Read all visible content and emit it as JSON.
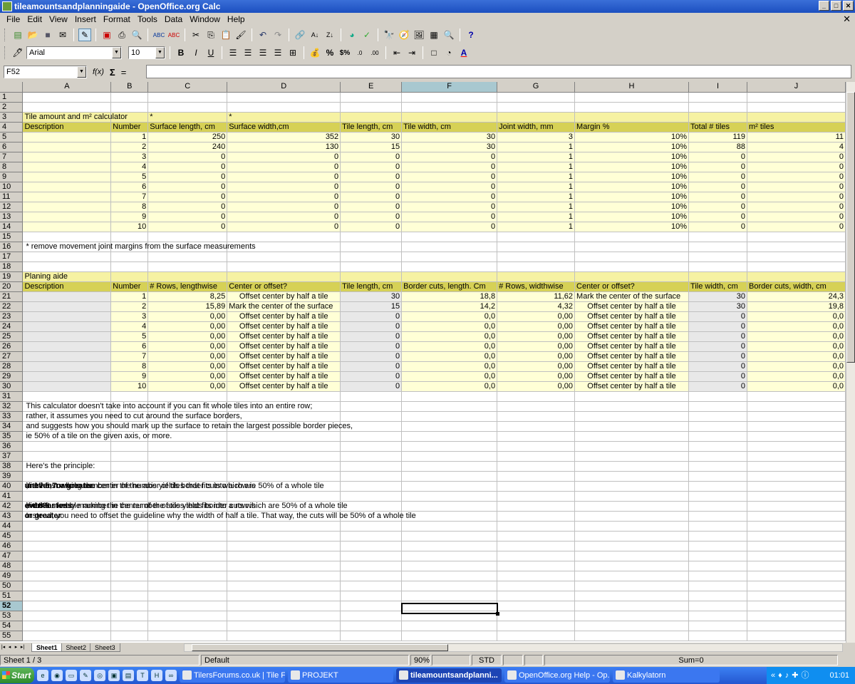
{
  "window": {
    "title": "tileamountsandplanningaide - OpenOffice.org Calc",
    "min": "_",
    "max": "□",
    "close": "✕"
  },
  "menu": [
    "File",
    "Edit",
    "View",
    "Insert",
    "Format",
    "Tools",
    "Data",
    "Window",
    "Help"
  ],
  "toolbar2": {
    "font": "Arial",
    "size": "10",
    "bold": "B",
    "italic": "I",
    "underline": "U",
    "percent": "%",
    "currency": "$%"
  },
  "formula": {
    "namebox": "F52",
    "fx": "f(x)",
    "sigma": "Σ",
    "equals": "="
  },
  "columns": [
    "A",
    "B",
    "C",
    "D",
    "E",
    "F",
    "G",
    "H",
    "I",
    "J"
  ],
  "selected_column": "F",
  "selected_row": "52",
  "calc": {
    "title": "Tile amount and m² calculator",
    "star": "*",
    "headers": [
      "Description",
      "Number",
      "Surface length, cm",
      "Surface width,cm",
      "Tile length, cm",
      "Tile width, cm",
      "Joint width, mm",
      "Margin %",
      "Total # tiles",
      "m² tiles"
    ],
    "rows": [
      [
        "",
        "1",
        "250",
        "352",
        "30",
        "30",
        "3",
        "10%",
        "119",
        "11"
      ],
      [
        "",
        "2",
        "240",
        "130",
        "15",
        "30",
        "1",
        "10%",
        "88",
        "4"
      ],
      [
        "",
        "3",
        "0",
        "0",
        "0",
        "0",
        "1",
        "10%",
        "0",
        "0"
      ],
      [
        "",
        "4",
        "0",
        "0",
        "0",
        "0",
        "1",
        "10%",
        "0",
        "0"
      ],
      [
        "",
        "5",
        "0",
        "0",
        "0",
        "0",
        "1",
        "10%",
        "0",
        "0"
      ],
      [
        "",
        "6",
        "0",
        "0",
        "0",
        "0",
        "1",
        "10%",
        "0",
        "0"
      ],
      [
        "",
        "7",
        "0",
        "0",
        "0",
        "0",
        "1",
        "10%",
        "0",
        "0"
      ],
      [
        "",
        "8",
        "0",
        "0",
        "0",
        "0",
        "1",
        "10%",
        "0",
        "0"
      ],
      [
        "",
        "9",
        "0",
        "0",
        "0",
        "0",
        "1",
        "10%",
        "0",
        "0"
      ],
      [
        "",
        "10",
        "0",
        "0",
        "0",
        "0",
        "1",
        "10%",
        "0",
        "0"
      ]
    ],
    "note": "* remove movement joint margins from the surface measurements"
  },
  "plan": {
    "title": "Planing aide",
    "headers": [
      "Description",
      "Number",
      "# Rows, lengthwise",
      "Center or offset?",
      "Tile length, cm",
      "Border cuts, length. Cm",
      "# Rows, widthwise",
      "Center or offset?",
      "Tile width, cm",
      "Border cuts, width, cm"
    ],
    "rows": [
      [
        "",
        "1",
        "8,25",
        "Offset center by half a tile",
        "30",
        "18,8",
        "11,62",
        "Mark the center of the surface",
        "30",
        "24,3"
      ],
      [
        "",
        "2",
        "15,89",
        "Mark the center of the surface",
        "15",
        "14,2",
        "4,32",
        "Offset center by half a tile",
        "30",
        "19,8"
      ],
      [
        "",
        "3",
        "0,00",
        "Offset center by half a tile",
        "0",
        "0,0",
        "0,00",
        "Offset center by half a tile",
        "0",
        "0,0"
      ],
      [
        "",
        "4",
        "0,00",
        "Offset center by half a tile",
        "0",
        "0,0",
        "0,00",
        "Offset center by half a tile",
        "0",
        "0,0"
      ],
      [
        "",
        "5",
        "0,00",
        "Offset center by half a tile",
        "0",
        "0,0",
        "0,00",
        "Offset center by half a tile",
        "0",
        "0,0"
      ],
      [
        "",
        "6",
        "0,00",
        "Offset center by half a tile",
        "0",
        "0,0",
        "0,00",
        "Offset center by half a tile",
        "0",
        "0,0"
      ],
      [
        "",
        "7",
        "0,00",
        "Offset center by half a tile",
        "0",
        "0,0",
        "0,00",
        "Offset center by half a tile",
        "0",
        "0,0"
      ],
      [
        "",
        "8",
        "0,00",
        "Offset center by half a tile",
        "0",
        "0,0",
        "0,00",
        "Offset center by half a tile",
        "0",
        "0,0"
      ],
      [
        "",
        "9",
        "0,00",
        "Offset center by half a tile",
        "0",
        "0,0",
        "0,00",
        "Offset center by half a tile",
        "0",
        "0,0"
      ],
      [
        "",
        "10",
        "0,00",
        "Offset center by half a tile",
        "0",
        "0,0",
        "0,00",
        "Offset center by half a tile",
        "0",
        "0,0"
      ]
    ]
  },
  "text": {
    "r32": "This calculator doesn't take into account if you can fit whole tiles into an entire row;",
    "r33": "rather, it assumes you need to cut around the surface borders,",
    "r34": "and suggests how you should mark up the surface to retain the largest possible border pieces,",
    "r35": " ie 50% of a tile on the given axis, or more.",
    "r38": "Here's the principle:",
    "r40": [
      "If the last whole number in the number of tiles that fits into a row is ",
      "uneven",
      ", ie the ",
      "7",
      " in 17.5, marking the center of the axis yields border cuts which are 50% of a whole tile ",
      "or greater."
    ],
    "r42": [
      "If the last whole number in the number of tiles that fits into a row is ",
      "even",
      ", ie the ",
      "8",
      " in 18.3 merely marking the center of the axis yields border cuts which are 50% of a whole tile ",
      "or less."
    ],
    "r43": [
      "Instead, you need to offset the guideline why the width of half a tile. That way, the cuts will be 50% of a whole tile ",
      "or greater"
    ]
  },
  "sheets": [
    "Sheet1",
    "Sheet2",
    "Sheet3"
  ],
  "status": {
    "sheet": "Sheet 1 / 3",
    "style": "Default",
    "zoom": "90%",
    "mode": "STD",
    "sum": "Sum=0"
  },
  "taskbar": {
    "start": "Start",
    "tasks": [
      "TilersForums.co.uk | Tile F...",
      "PROJEKT",
      "tileamountsandplanni...",
      "OpenOffice.org Help - Op...",
      "Kalkylatorn"
    ],
    "active_task": "tileamountsandplanni...",
    "clock": "01:01"
  }
}
